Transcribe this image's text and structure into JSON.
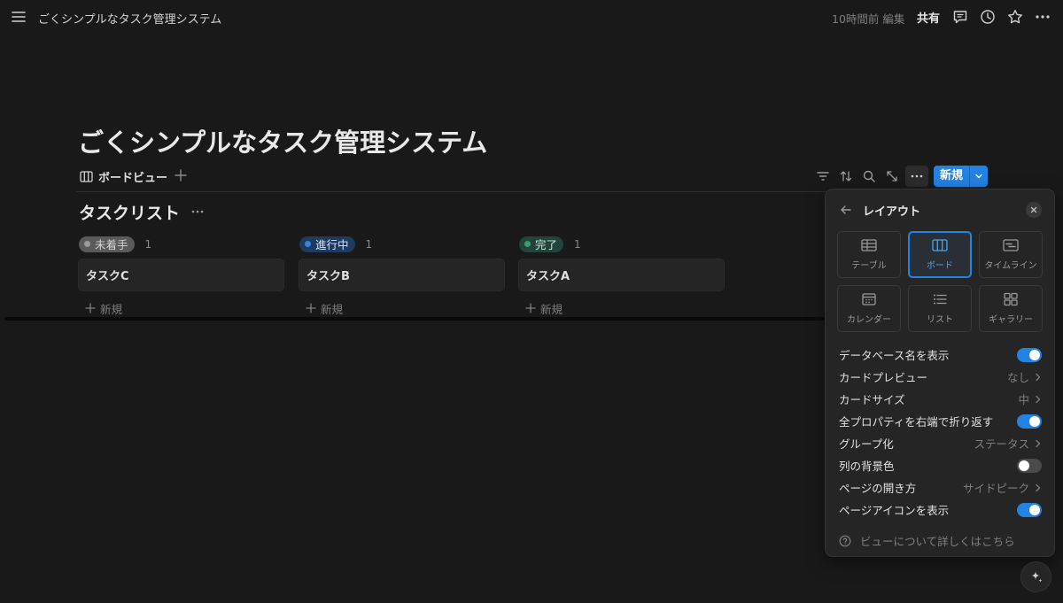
{
  "topbar": {
    "menu_icon": "hamburger-menu-icon",
    "title": "ごくシンプルなタスク管理システム",
    "edited": "10時間前 編集",
    "share_label": "共有",
    "icons": [
      "comment-icon",
      "history-clock-icon",
      "star-icon",
      "more-horizontal-icon"
    ]
  },
  "page": {
    "title": "ごくシンプルなタスク管理システム"
  },
  "view_bar": {
    "tab_label": "ボードビュー",
    "tab_icon": "board-view-icon",
    "tools": [
      "filter-icon",
      "sort-icon",
      "search-icon",
      "expand-icon",
      "more-icon"
    ],
    "new_label": "新規"
  },
  "database": {
    "title": "タスクリスト"
  },
  "board": {
    "columns": [
      {
        "status": "未着手",
        "count": "1",
        "color": "#5a5a5a",
        "dot": "#9b9b9b",
        "text_color": "#d4d4d4",
        "cards": [
          "タスクC"
        ],
        "new_label": "新規"
      },
      {
        "status": "進行中",
        "count": "1",
        "color": "#1e3a5f",
        "dot": "#3b82d6",
        "text_color": "#d4e4f7",
        "cards": [
          "タスクB"
        ],
        "new_label": "新規"
      },
      {
        "status": "完了",
        "count": "1",
        "color": "#23443a",
        "dot": "#3f9a72",
        "text_color": "#cfe9dc",
        "cards": [
          "タスクA"
        ],
        "new_label": "新規"
      }
    ]
  },
  "layout_panel": {
    "title": "レイアウト",
    "options": [
      {
        "label": "テーブル",
        "icon": "table-icon",
        "selected": false
      },
      {
        "label": "ボード",
        "icon": "board-icon",
        "selected": true
      },
      {
        "label": "タイムライン",
        "icon": "timeline-icon",
        "selected": false
      },
      {
        "label": "カレンダー",
        "icon": "calendar-icon",
        "selected": false
      },
      {
        "label": "リスト",
        "icon": "list-icon",
        "selected": false
      },
      {
        "label": "ギャラリー",
        "icon": "gallery-icon",
        "selected": false
      }
    ],
    "settings": [
      {
        "label": "データベース名を表示",
        "type": "toggle",
        "on": true
      },
      {
        "label": "カードプレビュー",
        "type": "select",
        "value": "なし"
      },
      {
        "label": "カードサイズ",
        "type": "select",
        "value": "中"
      },
      {
        "label": "全プロパティを右端で折り返す",
        "type": "toggle",
        "on": true
      },
      {
        "label": "グループ化",
        "type": "select",
        "value": "ステータス"
      },
      {
        "label": "列の背景色",
        "type": "toggle",
        "on": false
      },
      {
        "label": "ページの開き方",
        "type": "select",
        "value": "サイドピーク"
      },
      {
        "label": "ページアイコンを表示",
        "type": "toggle",
        "on": true
      }
    ],
    "help_label": "ビューについて詳しくはこちら"
  },
  "colors": {
    "background": "#191919",
    "accent": "#2383e2"
  }
}
